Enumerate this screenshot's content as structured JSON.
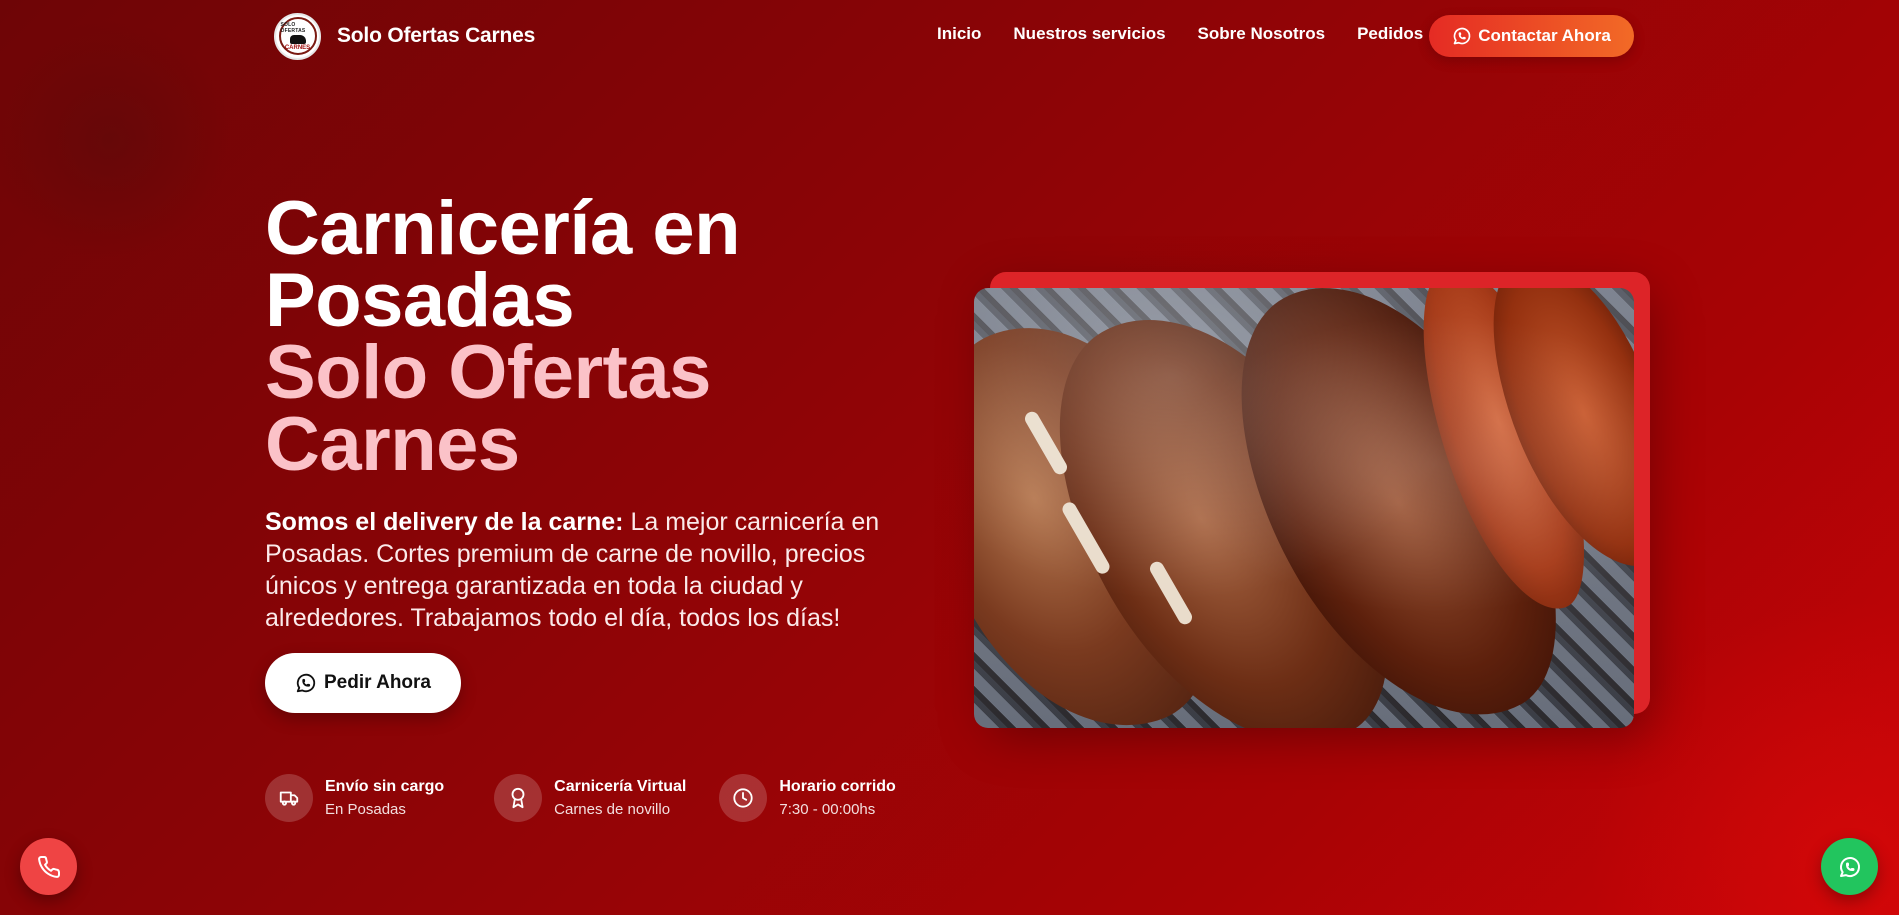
{
  "brand": {
    "name": "Solo Ofertas Carnes",
    "logo_text_top": "SOLO OFERTAS",
    "logo_text_bottom": "CARNES"
  },
  "nav": {
    "links": [
      {
        "label": "Inicio"
      },
      {
        "label": "Nuestros servicios"
      },
      {
        "label": "Sobre Nosotros"
      },
      {
        "label": "Pedidos"
      }
    ],
    "cta_label": "Contactar Ahora",
    "cta_icon": "whatsapp-icon"
  },
  "hero": {
    "title_line1": "Carnicería en",
    "title_line2": "Posadas",
    "subtitle_line1": "Solo Ofertas",
    "subtitle_line2": "Carnes",
    "desc_bold": "Somos el delivery de la carne:",
    "desc_text": " La mejor carnicería en Posadas. Cortes premium de carne de novillo, precios únicos y entrega garantizada en toda la ciudad y alrededores. Trabajamos todo el día, todos los días!",
    "button_label": "Pedir Ahora",
    "button_icon": "whatsapp-icon"
  },
  "features": [
    {
      "icon": "truck-icon",
      "title": "Envío sin cargo",
      "subtitle": "En Posadas"
    },
    {
      "icon": "award-icon",
      "title": "Carnicería Virtual",
      "subtitle": "Carnes de novillo"
    },
    {
      "icon": "clock-icon",
      "title": "Horario corrido",
      "subtitle": "7:30 - 00:00hs"
    }
  ],
  "floating": {
    "phone_icon": "phone-icon",
    "whatsapp_icon": "whatsapp-icon"
  },
  "colors": {
    "background_start": "#6e0506",
    "background_end": "#c90407",
    "accent_pink": "#fbc2c8",
    "cta_gradient_start": "#e52b24",
    "cta_gradient_end": "#f26a26",
    "image_backplate": "#dd2428",
    "phone_fab": "#ef4444",
    "whatsapp_fab": "#22c55e"
  }
}
